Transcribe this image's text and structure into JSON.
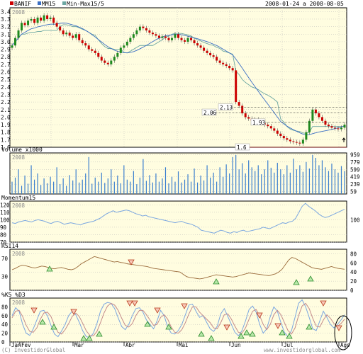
{
  "header": {
    "legend": [
      {
        "label": "BANIF",
        "color": "#cc0000"
      },
      {
        "label": "MM15",
        "color": "#3b6fc4"
      },
      {
        "label": "Min-Max15/5",
        "color": "#6ca7a2"
      }
    ],
    "date_range": "2008-01-24 a 2008-08-05",
    "year": "2008"
  },
  "footer": {
    "copyright": "(C) InvestidorGlobal",
    "website": "www.investidorglobal.com"
  },
  "colors": {
    "panel_bg": "#fffde0",
    "grid": "#b9b9b9",
    "up": "#1f8a1f",
    "down": "#cc0000",
    "ma": "#3b6fc4",
    "minmax": "#6ca7a2",
    "volume": "#3b7fcf",
    "momentum": "#7aa6e0",
    "rsi": "#9a6a3a",
    "k": "#7aa6e0",
    "d": "#c48a8a"
  },
  "chart_data": [
    {
      "type": "candlestick",
      "panel": "BANIF",
      "ylim": [
        1.6,
        3.45
      ],
      "y_ticks": [
        "3.4",
        "3.3",
        "3.2",
        "3.1",
        "3.0",
        "2.9",
        "2.8",
        "2.7",
        "2.6",
        "2.5",
        "2.4",
        "2.3",
        "2.2",
        "2.1",
        "2.0",
        "1.9",
        "1.8",
        "1.7",
        "1.6"
      ],
      "x_labels": [
        "Jan",
        "Fev",
        "Mar",
        "Abr",
        "Mai",
        "Jun",
        "Jul",
        "Ago"
      ],
      "annotations": [
        {
          "text": "2.13",
          "value": 2.13
        },
        {
          "text": "2.06",
          "value": 2.06
        },
        {
          "text": "1.93",
          "value": 1.93
        },
        {
          "text": "1.6",
          "value": 1.6
        }
      ],
      "close_series": [
        2.95,
        3.05,
        3.15,
        3.25,
        3.22,
        3.28,
        3.3,
        3.25,
        3.32,
        3.28,
        3.35,
        3.3,
        3.32,
        3.25,
        3.2,
        3.15,
        3.1,
        3.12,
        3.08,
        3.05,
        3.1,
        3.02,
        2.98,
        2.95,
        2.9,
        2.88,
        2.85,
        2.8,
        2.75,
        2.72,
        2.7,
        2.75,
        2.8,
        2.85,
        2.92,
        2.95,
        3.0,
        3.05,
        3.1,
        3.15,
        3.2,
        3.18,
        3.15,
        3.12,
        3.1,
        3.08,
        3.05,
        3.07,
        3.05,
        3.02,
        3.05,
        3.1,
        3.05,
        3.02,
        3.0,
        3.05,
        3.02,
        2.98,
        2.95,
        2.92,
        2.88,
        2.85,
        2.82,
        2.8,
        2.75,
        2.72,
        2.7,
        2.68,
        2.65,
        2.62,
        2.2,
        2.15,
        2.05,
        2.0,
        1.98,
        1.95,
        1.97,
        1.93,
        1.92,
        1.9,
        1.88,
        1.85,
        1.82,
        1.78,
        1.75,
        1.72,
        1.7,
        1.68,
        1.67,
        1.66,
        1.65,
        1.7,
        1.8,
        1.95,
        2.1,
        2.05,
        2.0,
        1.95,
        1.9,
        1.88,
        1.86,
        1.85,
        1.84,
        1.86,
        1.9
      ]
    },
    {
      "type": "bar",
      "panel": "Volume",
      "title": "Volume x1000",
      "y_ticks": [
        "959",
        "779",
        "599",
        "419",
        "239",
        "59"
      ],
      "ylim": [
        0,
        1000
      ],
      "values": [
        300,
        400,
        600,
        200,
        450,
        250,
        700,
        350,
        500,
        220,
        380,
        260,
        420,
        300,
        650,
        240,
        380,
        200,
        460,
        330,
        600,
        280,
        350,
        500,
        900,
        250,
        400,
        300,
        520,
        270,
        380,
        600,
        300,
        450,
        260,
        700,
        350,
        300,
        560,
        240,
        400,
        850,
        320,
        460,
        280,
        500,
        300,
        380,
        650,
        260,
        420,
        300,
        550,
        280,
        350,
        480,
        300,
        620,
        280,
        450,
        330,
        700,
        400,
        520,
        300,
        650,
        420,
        720,
        500,
        900,
        950,
        600,
        750,
        500,
        820,
        650,
        560,
        700,
        480,
        600,
        820,
        640,
        520,
        760,
        600,
        480,
        700,
        520,
        860,
        600,
        700,
        540,
        780,
        620,
        950,
        880,
        700,
        820,
        650,
        560,
        740,
        600,
        520,
        680,
        560
      ]
    },
    {
      "type": "line",
      "panel": "Momentum15",
      "title": "Momentum15",
      "y_ticks": [
        "120",
        "110",
        "100",
        "90",
        "80",
        "70"
      ],
      "right_ticks": [
        "100"
      ],
      "ylim": [
        70,
        125
      ],
      "values": [
        96,
        95,
        97,
        98,
        99,
        98,
        97,
        99,
        100,
        99,
        98,
        96,
        95,
        97,
        98,
        96,
        94,
        95,
        96,
        95,
        94,
        93,
        95,
        96,
        97,
        98,
        100,
        102,
        105,
        108,
        110,
        112,
        110,
        111,
        112,
        113,
        112,
        110,
        108,
        107,
        105,
        106,
        104,
        103,
        102,
        101,
        100,
        99,
        98,
        97,
        96,
        97,
        98,
        96,
        95,
        94,
        92,
        90,
        86,
        85,
        84,
        83,
        82,
        84,
        86,
        85,
        83,
        82,
        84,
        83,
        85,
        86,
        84,
        85,
        86,
        87,
        88,
        90,
        89,
        88,
        90,
        92,
        94,
        96,
        95,
        97,
        98,
        102,
        110,
        118,
        122,
        118,
        115,
        112,
        108,
        105,
        103,
        104,
        106,
        108,
        110,
        112,
        114
      ]
    },
    {
      "type": "line",
      "panel": "RSI14",
      "title": "RSI14",
      "y_ticks": [
        "80",
        "60",
        "40",
        "20",
        "0"
      ],
      "left_ticks": [
        "70",
        "30"
      ],
      "ylim": [
        0,
        90
      ],
      "values": [
        45,
        48,
        52,
        55,
        54,
        52,
        50,
        49,
        51,
        53,
        52,
        50,
        48,
        47,
        49,
        50,
        48,
        46,
        45,
        47,
        52,
        58,
        62,
        66,
        70,
        74,
        72,
        70,
        68,
        66,
        64,
        62,
        63,
        61,
        60,
        58,
        57,
        56,
        55,
        54,
        53,
        52,
        50,
        48,
        47,
        46,
        45,
        44,
        43,
        42,
        41,
        40,
        35,
        30,
        28,
        27,
        26,
        25,
        26,
        28,
        30,
        32,
        34,
        33,
        32,
        31,
        30,
        29,
        30,
        32,
        34,
        36,
        38,
        37,
        36,
        35,
        34,
        33,
        32,
        34,
        36,
        40,
        46,
        56,
        66,
        72,
        70,
        66,
        62,
        58,
        54,
        50,
        48,
        47,
        46,
        48,
        50,
        52,
        50,
        48,
        47,
        46
      ]
    },
    {
      "type": "line",
      "panel": "Stochastic",
      "title": "%K5 %D3",
      "y_ticks": [
        "80",
        "60",
        "40",
        "20",
        "0"
      ],
      "ylim": [
        0,
        100
      ],
      "series": [
        {
          "name": "%K5",
          "values": [
            60,
            78,
            70,
            40,
            20,
            15,
            30,
            50,
            70,
            72,
            60,
            38,
            18,
            12,
            25,
            40,
            60,
            70,
            62,
            45,
            25,
            12,
            10,
            20,
            42,
            70,
            86,
            90,
            88,
            76,
            55,
            35,
            28,
            40,
            60,
            76,
            78,
            68,
            50,
            40,
            30,
            48,
            72,
            60,
            34,
            20,
            18,
            26,
            40,
            62,
            84,
            86,
            70,
            56,
            60,
            45,
            30,
            24,
            36,
            64,
            76,
            58,
            40,
            22,
            14,
            26,
            48,
            74,
            82,
            68,
            40,
            20,
            30,
            58,
            80,
            70,
            44,
            22,
            12,
            26,
            56,
            88,
            96,
            80,
            56,
            30,
            26,
            48,
            70,
            56,
            40,
            32,
            40,
            50,
            62
          ]
        },
        {
          "name": "%D3",
          "values": [
            55,
            70,
            72,
            58,
            38,
            24,
            22,
            32,
            52,
            66,
            68,
            58,
            38,
            22,
            18,
            28,
            42,
            58,
            66,
            58,
            42,
            25,
            15,
            14,
            24,
            44,
            66,
            82,
            88,
            84,
            72,
            54,
            38,
            34,
            42,
            60,
            72,
            72,
            62,
            50,
            38,
            40,
            56,
            62,
            52,
            34,
            22,
            20,
            28,
            44,
            64,
            80,
            80,
            68,
            60,
            52,
            44,
            32,
            30,
            44,
            62,
            64,
            52,
            36,
            22,
            20,
            32,
            52,
            70,
            74,
            60,
            40,
            28,
            40,
            62,
            72,
            62,
            44,
            26,
            18,
            32,
            60,
            82,
            88,
            76,
            54,
            36,
            34,
            50,
            62,
            54,
            42,
            36,
            42,
            52
          ]
        }
      ]
    }
  ]
}
